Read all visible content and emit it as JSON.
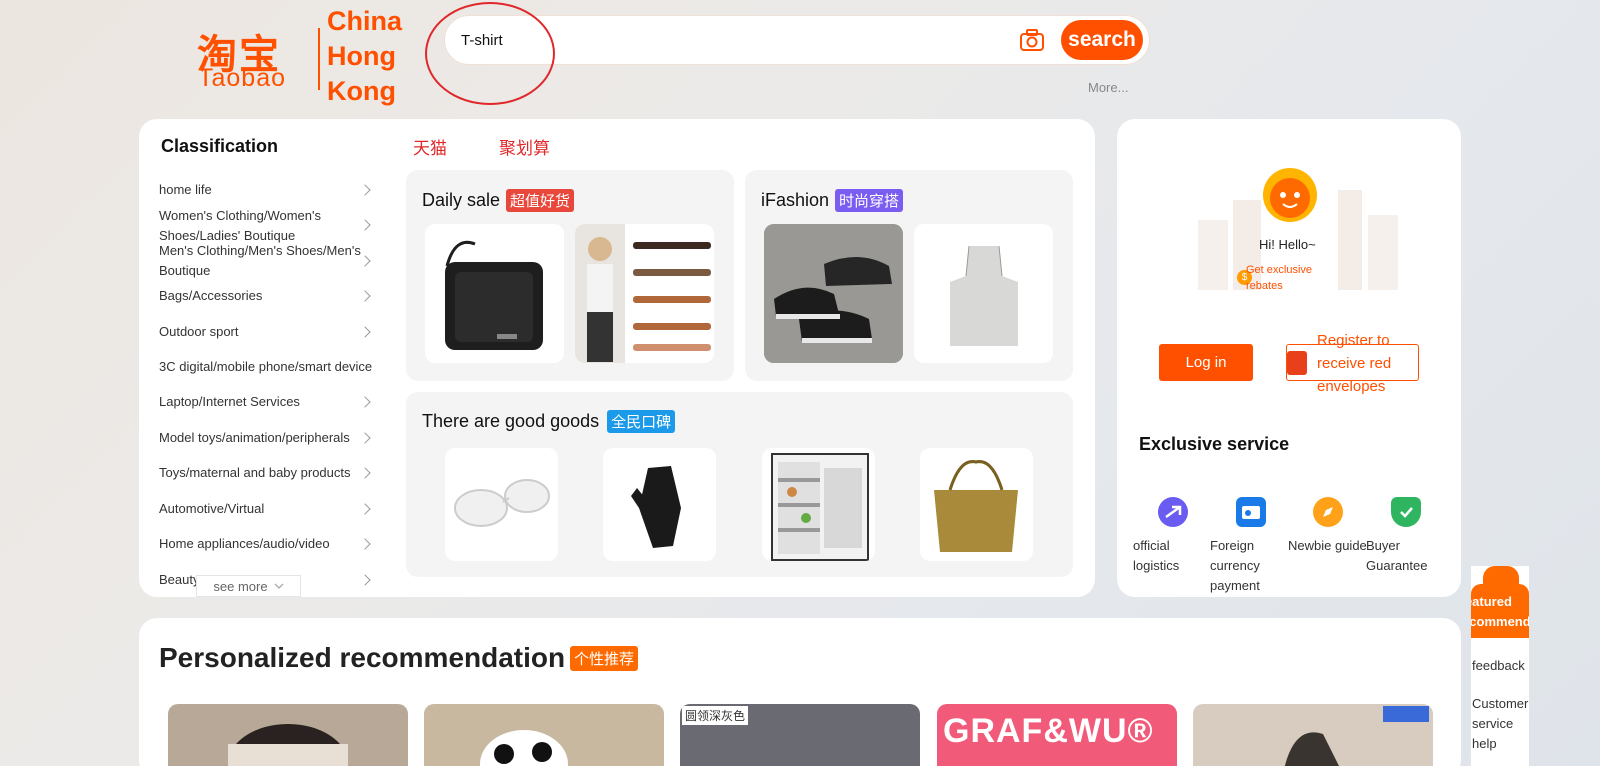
{
  "logo": {
    "chinese": "淘宝",
    "english": "Taobao",
    "region_lines": [
      "China",
      "Hong",
      "Kong"
    ]
  },
  "search": {
    "value": "T-shirt",
    "button_label": "search",
    "more_label": "More..."
  },
  "classification": {
    "title": "Classification",
    "items": [
      "home life",
      "Women's Clothing/Women's Shoes/Ladies' Boutique",
      "Men's Clothing/Men's Shoes/Men's Boutique",
      "Bags/Accessories",
      "Outdoor sport",
      "3C digital/mobile phone/smart device",
      "Laptop/Internet Services",
      "Model toys/animation/peripherals",
      "Toys/maternal and baby products",
      "Automotive/Virtual",
      "Home appliances/audio/video",
      "Beauty"
    ],
    "see_more": "see more"
  },
  "tabs": [
    "天猫",
    "聚划算"
  ],
  "cards": {
    "daily_sale": {
      "title": "Daily sale",
      "tag": "超值好货",
      "tag_color": "#e8473b"
    },
    "ifashion": {
      "title": "iFashion",
      "tag": "时尚穿搭",
      "tag_color": "#7b5cf0"
    },
    "good_goods": {
      "title": "There are good goods",
      "tag": "全民口碑",
      "tag_color": "#1a9ae8"
    }
  },
  "user": {
    "greeting": "Hi! Hello~",
    "rebate": "Get exclusive rebates",
    "login": "Log in",
    "register": "Register to receive red envelopes"
  },
  "services": {
    "title": "Exclusive service",
    "items": [
      {
        "label": "official logistics",
        "icon": "plane-icon",
        "color": "#6a5cf0"
      },
      {
        "label": "Foreign currency payment",
        "icon": "wallet-icon",
        "color": "#1a7ae8"
      },
      {
        "label": "Newbie guide",
        "icon": "compass-icon",
        "color": "#ffa21a"
      },
      {
        "label": "Buyer Guarantee",
        "icon": "shield-icon",
        "color": "#2fb560"
      }
    ]
  },
  "side": {
    "featured": "Featured recommend",
    "feedback": "feedback",
    "customer_service": "Customer service help"
  },
  "recommendation": {
    "title": "Personalized recommendation",
    "tag": "个性推荐",
    "item_text": "GRAF&WU®",
    "item_label": "圆领深灰色"
  },
  "colors": {
    "brand": "#ff5000",
    "accent_red": "#e0282a"
  }
}
